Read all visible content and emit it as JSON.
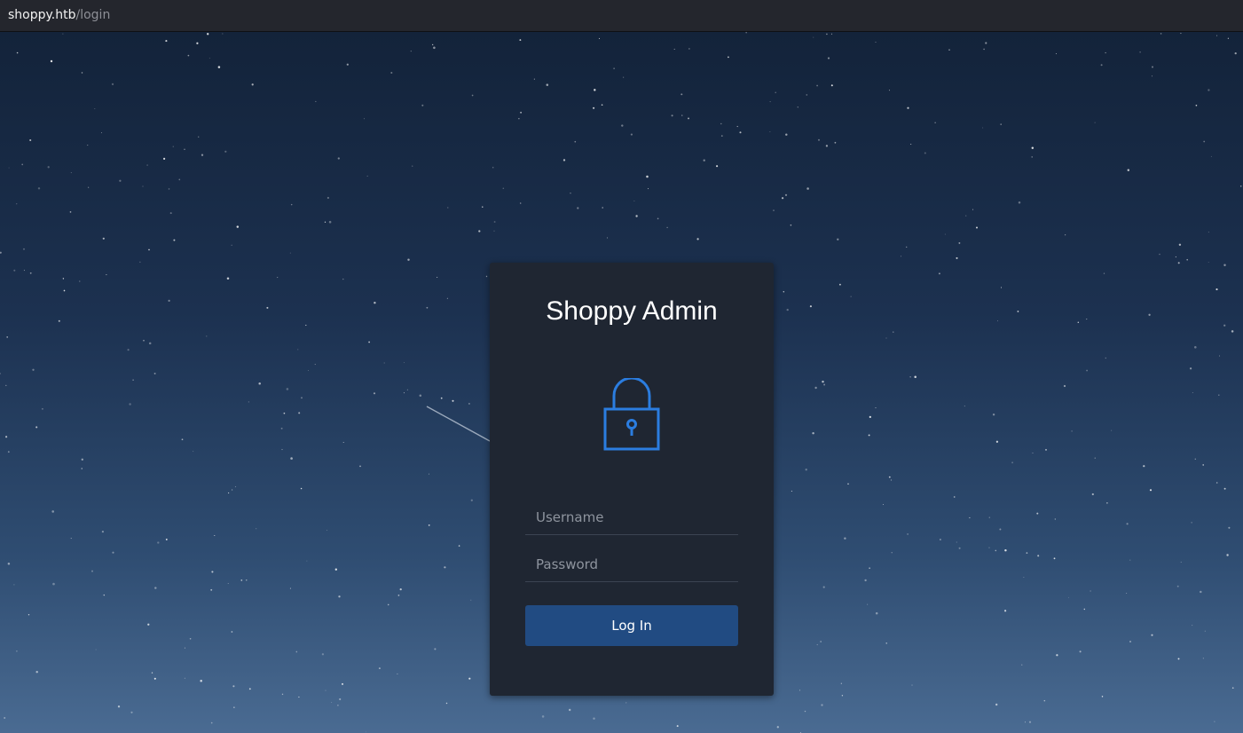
{
  "address_bar": {
    "host": "shoppy.htb",
    "path": "/login"
  },
  "login": {
    "title": "Shoppy Admin",
    "icon": "lock-icon",
    "username_placeholder": "Username",
    "username_value": "",
    "password_placeholder": "Password",
    "password_value": "",
    "button_label": "Log In"
  },
  "colors": {
    "card_background": "#1f2632",
    "accent": "#2b7de0",
    "button": "#214b82"
  }
}
